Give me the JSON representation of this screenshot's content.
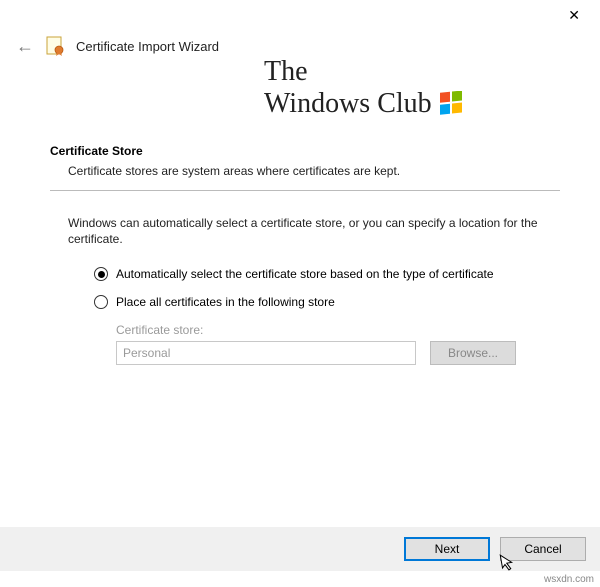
{
  "window": {
    "title": "Certificate Import Wizard"
  },
  "watermark": {
    "line1": "The",
    "line2": "Windows Club"
  },
  "section": {
    "heading": "Certificate Store",
    "description": "Certificate stores are system areas where certificates are kept."
  },
  "instruction": "Windows can automatically select a certificate store, or you can specify a location for the certificate.",
  "options": {
    "auto": "Automatically select the certificate store based on the type of certificate",
    "manual": "Place all certificates in the following store",
    "selected": "auto"
  },
  "store_field": {
    "label": "Certificate store:",
    "value": "Personal",
    "browse_label": "Browse..."
  },
  "footer": {
    "next_label": "Next",
    "cancel_label": "Cancel"
  },
  "attribution": "wsxdn.com"
}
